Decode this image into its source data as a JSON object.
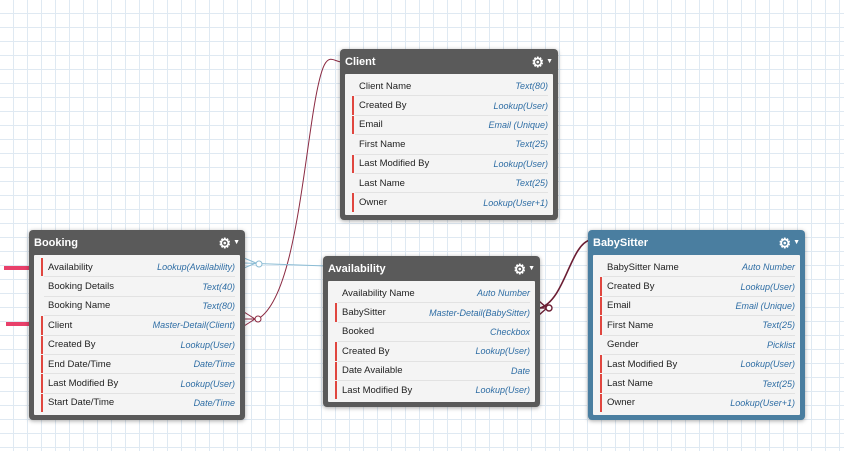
{
  "colors": {
    "required_marker": "#e0463f",
    "type_text": "#2e6da4",
    "entity_header": "#5a5a5a",
    "babysitter_header": "#4a7ea0",
    "master_detail_link": "#8b2a42",
    "lookup_link": "#8bbcd4",
    "pointer_arrow": "#e8406a"
  },
  "entities": {
    "client": {
      "title": "Client",
      "fields": [
        {
          "name": "Client Name",
          "type": "Text(80)"
        },
        {
          "name": "Created By",
          "type": "Lookup(User)"
        },
        {
          "name": "Email",
          "type": "Email (Unique)"
        },
        {
          "name": "First Name",
          "type": "Text(25)"
        },
        {
          "name": "Last Modified By",
          "type": "Lookup(User)"
        },
        {
          "name": "Last Name",
          "type": "Text(25)"
        },
        {
          "name": "Owner",
          "type": "Lookup(User+1)"
        }
      ]
    },
    "booking": {
      "title": "Booking",
      "fields": [
        {
          "name": "Availability",
          "type": "Lookup(Availability)"
        },
        {
          "name": "Booking Details",
          "type": "Text(40)"
        },
        {
          "name": "Booking Name",
          "type": "Text(80)"
        },
        {
          "name": "Client",
          "type": "Master-Detail(Client)"
        },
        {
          "name": "Created By",
          "type": "Lookup(User)"
        },
        {
          "name": "End Date/Time",
          "type": "Date/Time"
        },
        {
          "name": "Last Modified By",
          "type": "Lookup(User)"
        },
        {
          "name": "Start Date/Time",
          "type": "Date/Time"
        }
      ]
    },
    "availability": {
      "title": "Availability",
      "fields": [
        {
          "name": "Availability Name",
          "type": "Auto Number"
        },
        {
          "name": "BabySitter",
          "type": "Master-Detail(BabySitter)"
        },
        {
          "name": "Booked",
          "type": "Checkbox"
        },
        {
          "name": "Created By",
          "type": "Lookup(User)"
        },
        {
          "name": "Date Available",
          "type": "Date"
        },
        {
          "name": "Last Modified By",
          "type": "Lookup(User)"
        }
      ]
    },
    "babysitter": {
      "title": "BabySitter",
      "fields": [
        {
          "name": "BabySitter Name",
          "type": "Auto Number"
        },
        {
          "name": "Created By",
          "type": "Lookup(User)"
        },
        {
          "name": "Email",
          "type": "Email (Unique)"
        },
        {
          "name": "First Name",
          "type": "Text(25)"
        },
        {
          "name": "Gender",
          "type": "Picklist"
        },
        {
          "name": "Last Modified By",
          "type": "Lookup(User)"
        },
        {
          "name": "Last Name",
          "type": "Text(25)"
        },
        {
          "name": "Owner",
          "type": "Lookup(User+1)"
        }
      ]
    }
  }
}
